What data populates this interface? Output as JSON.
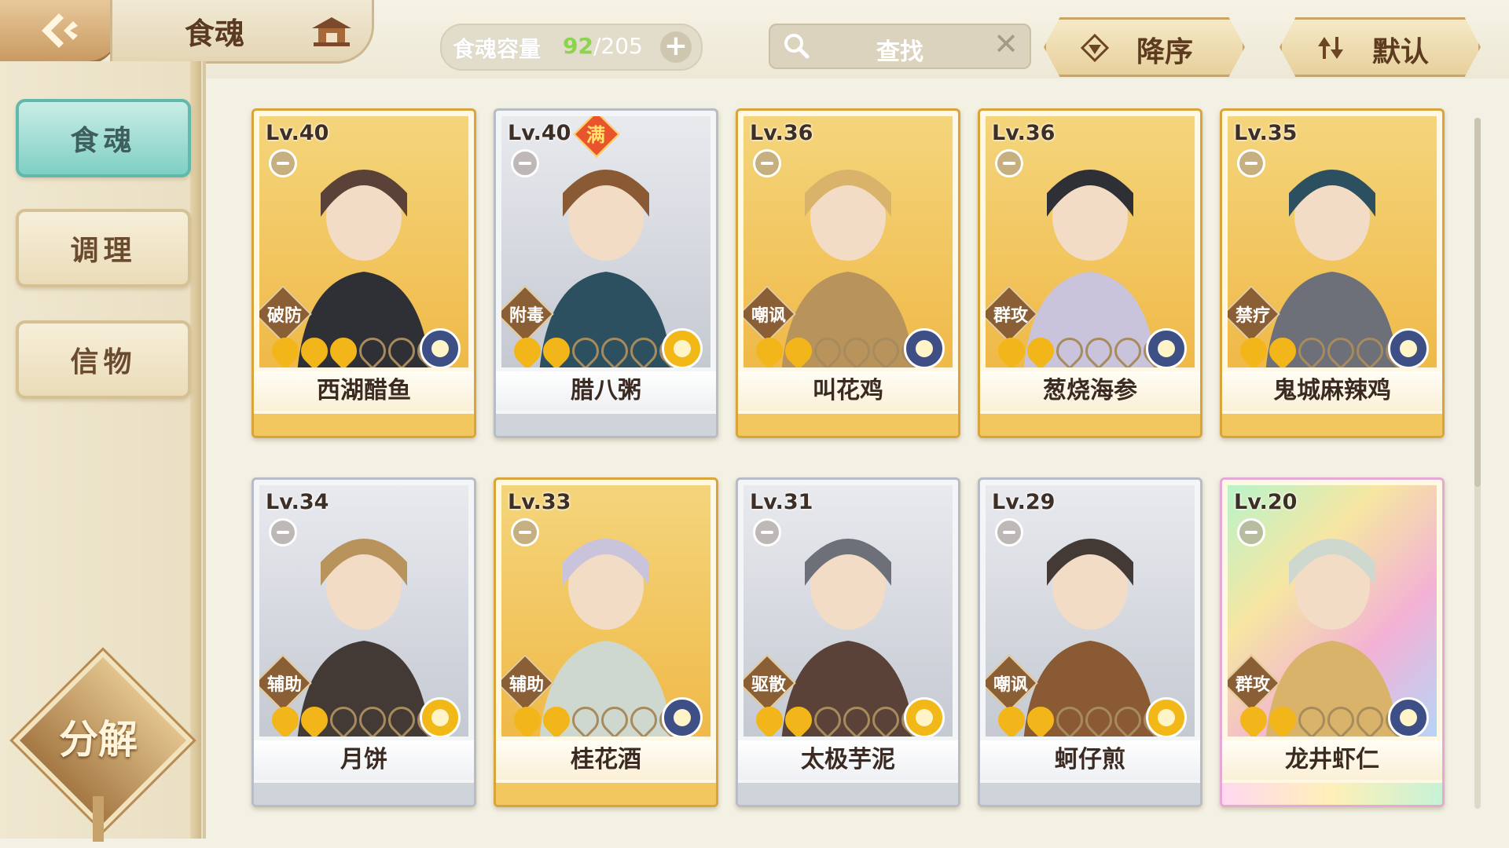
{
  "header": {
    "title": "食魂",
    "capacity_label": "食魂容量",
    "capacity_current": "92",
    "capacity_max": "/205",
    "search_placeholder": "查找",
    "sort_order_label": "降序",
    "sort_mode_label": "默认"
  },
  "sidebar": {
    "items": [
      {
        "label": "食魂",
        "active": true
      },
      {
        "label": "调理",
        "active": false
      },
      {
        "label": "信物",
        "active": false
      }
    ],
    "decompose_label": "分解"
  },
  "cards": [
    {
      "level": "Lv.40",
      "name": "西湖醋鱼",
      "role": "破防",
      "stars_filled": 3,
      "frame": "gold",
      "attr": "navy-flower",
      "max_badge": ""
    },
    {
      "level": "Lv.40",
      "name": "腊八粥",
      "role": "附毒",
      "stars_filled": 2,
      "frame": "silver",
      "attr": "gold-flower",
      "max_badge": "满"
    },
    {
      "level": "Lv.36",
      "name": "叫花鸡",
      "role": "嘲讽",
      "stars_filled": 2,
      "frame": "gold",
      "attr": "navy-flower",
      "max_badge": ""
    },
    {
      "level": "Lv.36",
      "name": "葱烧海参",
      "role": "群攻",
      "stars_filled": 2,
      "frame": "gold",
      "attr": "navy-flower",
      "max_badge": ""
    },
    {
      "level": "Lv.35",
      "name": "鬼城麻辣鸡",
      "role": "禁疗",
      "stars_filled": 2,
      "frame": "gold",
      "attr": "navy-flower",
      "max_badge": ""
    },
    {
      "level": "Lv.34",
      "name": "月饼",
      "role": "辅助",
      "stars_filled": 2,
      "frame": "silver",
      "attr": "gold-flower",
      "max_badge": ""
    },
    {
      "level": "Lv.33",
      "name": "桂花酒",
      "role": "辅助",
      "stars_filled": 2,
      "frame": "gold",
      "attr": "navy-flower",
      "max_badge": ""
    },
    {
      "level": "Lv.31",
      "name": "太极芋泥",
      "role": "驱散",
      "stars_filled": 2,
      "frame": "silver",
      "attr": "gold-flower",
      "max_badge": ""
    },
    {
      "level": "Lv.29",
      "name": "蚵仔煎",
      "role": "嘲讽",
      "stars_filled": 2,
      "frame": "silver",
      "attr": "gold-flower",
      "max_badge": ""
    },
    {
      "level": "Lv.20",
      "name": "龙井虾仁",
      "role": "群攻",
      "stars_filled": 2,
      "frame": "rainbow",
      "attr": "navy-flower",
      "max_badge": ""
    }
  ],
  "colors": {
    "gold_frame": "#d9a43a",
    "silver_frame": "#b8bcc4",
    "star_on": "#f3b61a",
    "active_tab": "#7fcfc4",
    "capacity_current": "#8cd34e",
    "attr_navy": "#3d4f84",
    "attr_gold": "#f2b817"
  }
}
